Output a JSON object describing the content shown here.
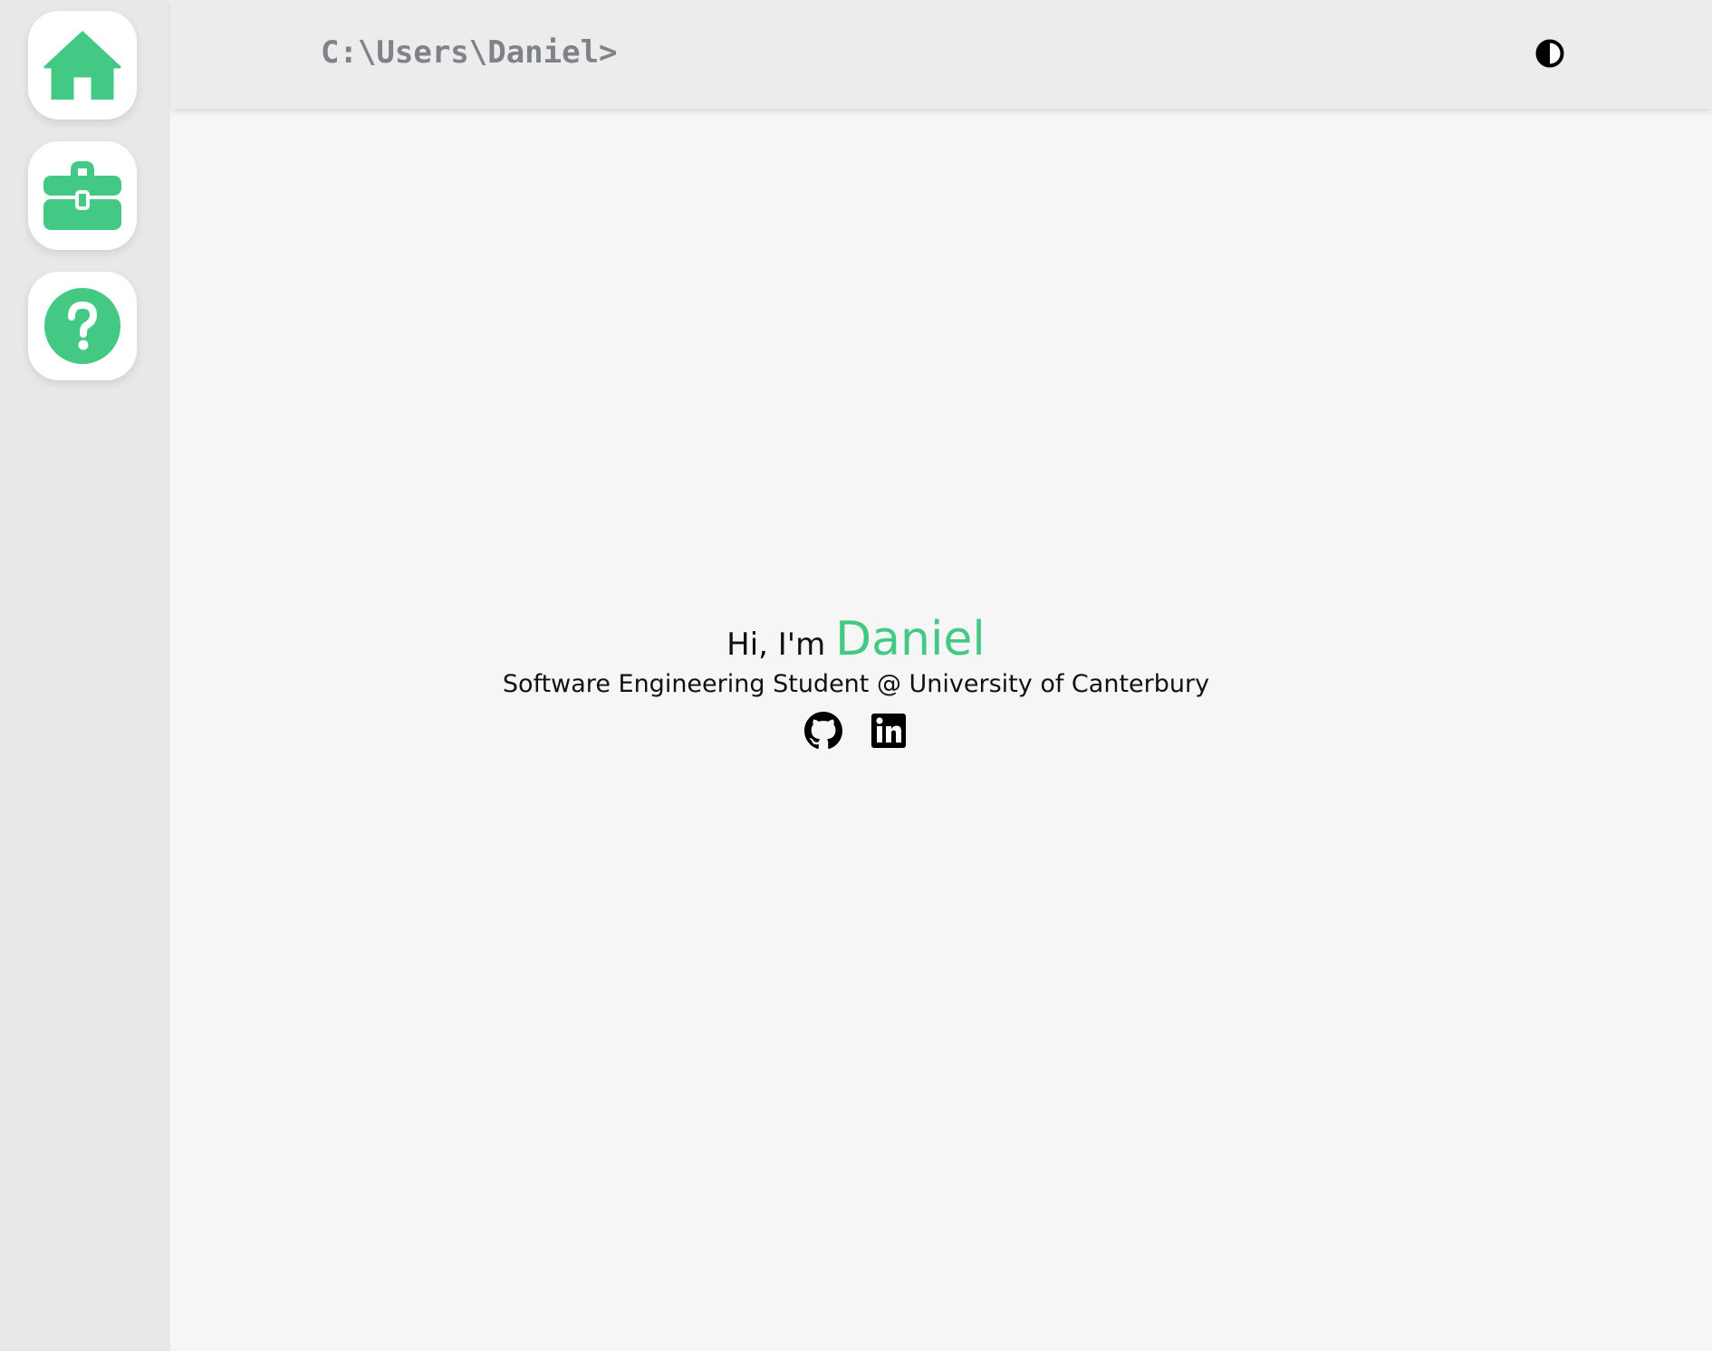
{
  "colors": {
    "accent": "#44c985",
    "sidebar_bg": "#e8e8e8",
    "topbar_bg": "#ececec",
    "page_bg": "#f6f6f6",
    "prompt_text": "#7f8288",
    "text": "#111111"
  },
  "sidebar": {
    "items": [
      {
        "name": "home",
        "icon": "house-icon"
      },
      {
        "name": "work",
        "icon": "briefcase-icon"
      },
      {
        "name": "help",
        "icon": "question-circle-icon"
      }
    ]
  },
  "header": {
    "prompt": "C:\\Users\\Daniel>",
    "theme_toggle_icon": "contrast-icon"
  },
  "hero": {
    "greeting_prefix": "Hi, I'm",
    "name": "Daniel",
    "subtitle": "Software Engineering Student @ University of Canterbury",
    "socials": [
      {
        "name": "GitHub",
        "icon": "github-icon"
      },
      {
        "name": "LinkedIn",
        "icon": "linkedin-icon"
      }
    ]
  }
}
